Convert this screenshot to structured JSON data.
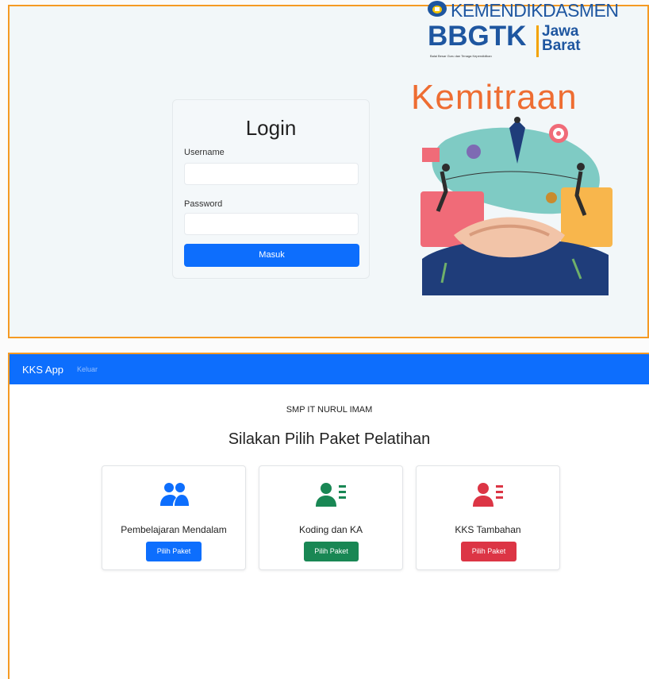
{
  "login": {
    "title": "Login",
    "username_label": "Username",
    "username_value": "",
    "password_label": "Password",
    "password_value": "",
    "submit_label": "Masuk"
  },
  "brand": {
    "ministry": "KEMENDIKDASMEN",
    "org": "BBGTK",
    "region_line1": "Jawa",
    "region_line2": "Barat",
    "org_full": "Balai Besar Guru dan Tenaga Kependidikan",
    "tagline": "Kemitraan"
  },
  "navbar": {
    "brand": "KKS App",
    "logout": "Keluar"
  },
  "school_name": "SMP IT NURUL IMAM",
  "heading": "Silakan Pilih Paket Pelatihan",
  "packages": [
    {
      "title": "Pembelajaran Mendalam",
      "button": "Pilih Paket",
      "icon": "users-icon",
      "color": "#0d6efd"
    },
    {
      "title": "Koding dan KA",
      "button": "Pilih Paket",
      "icon": "user-list-icon",
      "color": "#198754"
    },
    {
      "title": "KKS Tambahan",
      "button": "Pilih Paket",
      "icon": "user-list-icon",
      "color": "#dc3545"
    }
  ],
  "colors": {
    "primary": "#0d6efd",
    "success": "#198754",
    "danger": "#dc3545",
    "accent_orange": "#ee6d32",
    "frame_border": "#f59a23"
  }
}
